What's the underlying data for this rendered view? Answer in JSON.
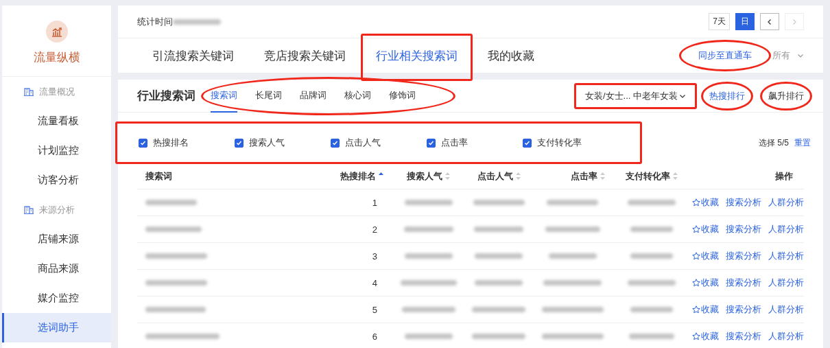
{
  "sidebar": {
    "logo_text": "流量纵横",
    "sections": [
      {
        "title": "流量概况",
        "items": [
          {
            "label": "流量看板",
            "selected": false
          },
          {
            "label": "计划监控",
            "selected": false
          },
          {
            "label": "访客分析",
            "selected": false
          }
        ]
      },
      {
        "title": "来源分析",
        "items": [
          {
            "label": "店铺来源",
            "selected": false
          },
          {
            "label": "商品来源",
            "selected": false
          },
          {
            "label": "媒介监控",
            "selected": false
          },
          {
            "label": "选词助手",
            "selected": true
          }
        ]
      }
    ]
  },
  "header": {
    "stat_label": "统计时间",
    "period_buttons": [
      {
        "label": "7天",
        "selected": false
      },
      {
        "label": "日",
        "selected": true
      }
    ],
    "nav": [
      {
        "kind": "prev",
        "disabled": false
      },
      {
        "kind": "next",
        "disabled": true
      }
    ]
  },
  "tabs": [
    {
      "label": "引流搜索关键词",
      "selected": false,
      "boxed": false
    },
    {
      "label": "竞店搜索关键词",
      "selected": false,
      "boxed": false
    },
    {
      "label": "行业相关搜索词",
      "selected": true,
      "boxed": true
    },
    {
      "label": "我的收藏",
      "selected": false,
      "boxed": false
    }
  ],
  "tab_actions": {
    "sync_link": "同步至直通车",
    "sync_circled": true,
    "filter": "所有"
  },
  "panel": {
    "title": "行业搜索词",
    "subtabs_circled": true,
    "subtabs": [
      {
        "label": "搜索词",
        "selected": true
      },
      {
        "label": "长尾词",
        "selected": false
      },
      {
        "label": "品牌词",
        "selected": false
      },
      {
        "label": "核心词",
        "selected": false
      },
      {
        "label": "修饰词",
        "selected": false
      }
    ],
    "category": {
      "value": "女装/女士... 中老年女装",
      "boxed": true
    },
    "rankings": [
      {
        "label": "热搜排行",
        "selected": true,
        "circled": true
      },
      {
        "label": "飙升排行",
        "selected": false,
        "circled": true
      }
    ]
  },
  "metric_filter": {
    "boxed": true,
    "options": [
      {
        "label": "热搜排名",
        "checked": true
      },
      {
        "label": "搜索人气",
        "checked": true
      },
      {
        "label": "点击人气",
        "checked": true
      },
      {
        "label": "点击率",
        "checked": true
      },
      {
        "label": "支付转化率",
        "checked": true
      }
    ],
    "summary": "选择 5/5",
    "reset": "重置"
  },
  "table": {
    "columns": [
      {
        "label": "搜索词",
        "sortable": false
      },
      {
        "label": "热搜排名",
        "sortable": true,
        "sorted": true
      },
      {
        "label": "搜索人气",
        "sortable": true,
        "sorted": false
      },
      {
        "label": "点击人气",
        "sortable": true,
        "sorted": false
      },
      {
        "label": "点击率",
        "sortable": true,
        "sorted": false
      },
      {
        "label": "支付转化率",
        "sortable": true,
        "sorted": false
      },
      {
        "label": "操作",
        "sortable": false
      }
    ],
    "rows": [
      {
        "rank": "1",
        "actions": [
          "收藏",
          "搜索分析",
          "人群分析"
        ]
      },
      {
        "rank": "2",
        "actions": [
          "收藏",
          "搜索分析",
          "人群分析"
        ]
      },
      {
        "rank": "3",
        "actions": [
          "收藏",
          "搜索分析",
          "人群分析"
        ]
      },
      {
        "rank": "4",
        "actions": [
          "收藏",
          "搜索分析",
          "人群分析"
        ]
      },
      {
        "rank": "5",
        "actions": [
          "收藏",
          "搜索分析",
          "人群分析"
        ]
      },
      {
        "rank": "6",
        "actions": [
          "收藏",
          "搜索分析",
          "人群分析"
        ]
      }
    ]
  }
}
